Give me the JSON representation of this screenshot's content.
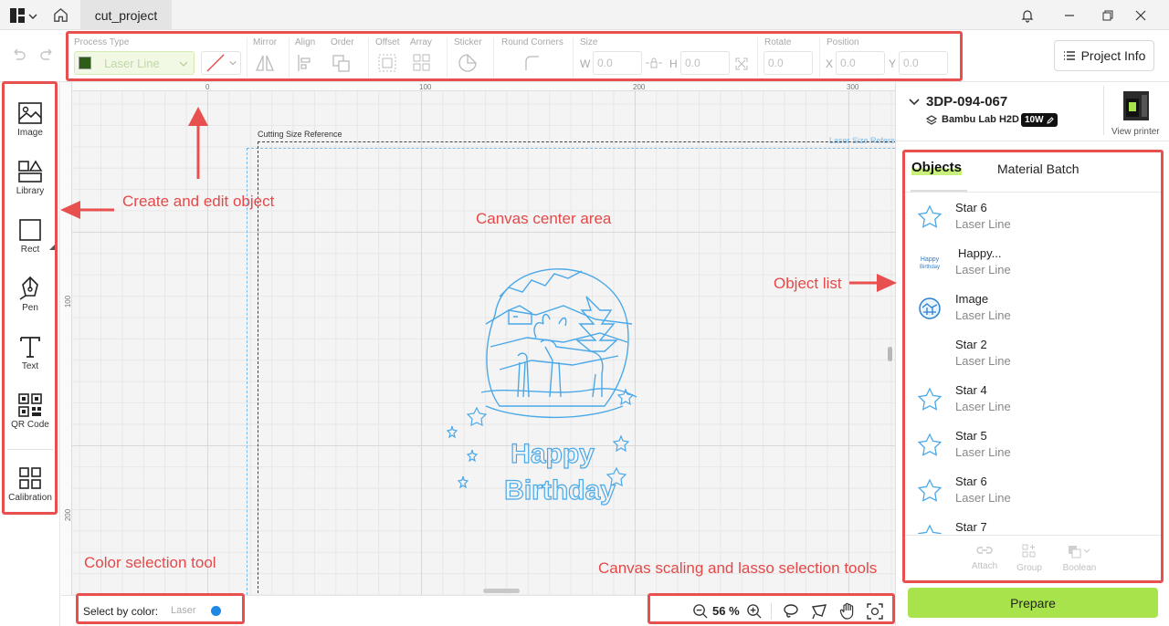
{
  "titlebar": {
    "tab_label": "cut_project"
  },
  "toolbar": {
    "process_type_label": "Process Type",
    "process_type_value": "Laser Line",
    "mirror_label": "Mirror",
    "align_label": "Align",
    "order_label": "Order",
    "offset_label": "Offset",
    "array_label": "Array",
    "sticker_label": "Sticker",
    "round_corners_label": "Round Corners",
    "size_label": "Size",
    "size_w_prefix": "W",
    "size_w_value": "0.0",
    "size_h_prefix": "H",
    "size_h_value": "0.0",
    "rotate_label": "Rotate",
    "rotate_value": "0.0",
    "position_label": "Position",
    "pos_x_prefix": "X",
    "pos_x_value": "0.0",
    "pos_y_prefix": "Y",
    "pos_y_value": "0.0",
    "project_info_label": "Project Info"
  },
  "left_tools": [
    {
      "label": "Image",
      "icon": "image-icon"
    },
    {
      "label": "Library",
      "icon": "library-icon"
    },
    {
      "label": "Rect",
      "icon": "rect-icon"
    },
    {
      "label": "Pen",
      "icon": "pen-icon"
    },
    {
      "label": "Text",
      "icon": "text-icon"
    },
    {
      "label": "QR Code",
      "icon": "qr-code-icon"
    },
    {
      "label": "Calibration",
      "icon": "calibration-icon"
    }
  ],
  "canvas": {
    "ruler_top": [
      "0",
      "100",
      "200",
      "300"
    ],
    "ruler_left": [
      "100",
      "200"
    ],
    "cutting_ref_label": "Cutting Size Reference",
    "laser_ref_label": "Laser Size Refere",
    "artwork_text_line1": "Happy",
    "artwork_text_line2": "Birthday"
  },
  "bottombar": {
    "select_by_color_label": "Select by color:",
    "laser_label": "Laser",
    "laser_color": "#1e88e5",
    "zoom_value": "56 %"
  },
  "printer": {
    "name": "3DP-094-067",
    "model": "Bambu Lab H2D",
    "power_badge": "10W",
    "view_printer_label": "View printer"
  },
  "objects_panel": {
    "tab_objects": "Objects",
    "tab_material_batch": "Material Batch",
    "items": [
      {
        "name": "Star 6",
        "type": "Laser Line",
        "thumb": "star"
      },
      {
        "name": "Happy...",
        "type": "Laser Line",
        "thumb": "text"
      },
      {
        "name": "Image",
        "type": "Laser Line",
        "thumb": "image"
      },
      {
        "name": "Star 2",
        "type": "Laser Line",
        "thumb": "none"
      },
      {
        "name": "Star 4",
        "type": "Laser Line",
        "thumb": "star"
      },
      {
        "name": "Star 5",
        "type": "Laser Line",
        "thumb": "star"
      },
      {
        "name": "Star 6",
        "type": "Laser Line",
        "thumb": "star"
      },
      {
        "name": "Star 7",
        "type": "",
        "thumb": "star"
      }
    ],
    "thumb_text_line1": "Happy",
    "thumb_text_line2": "Birthday",
    "attach_label": "Attach",
    "group_label": "Group",
    "boolean_label": "Boolean",
    "prepare_label": "Prepare"
  },
  "annotations": {
    "create_edit": "Create and edit object",
    "canvas_center": "Canvas center area",
    "object_list": "Object list",
    "color_selection": "Color selection tool",
    "canvas_scaling": "Canvas scaling and lasso selection tools"
  },
  "colors": {
    "accent_green": "#a9e34b",
    "annotation_red": "#e85050",
    "artwork_blue": "#4aa8e8"
  }
}
